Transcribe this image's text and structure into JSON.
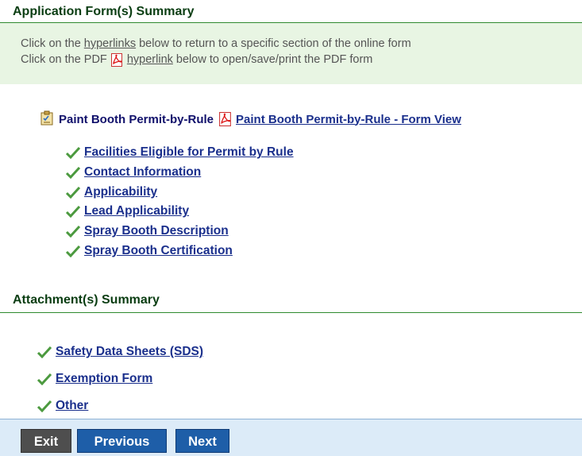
{
  "application": {
    "header": "Application Form(s) Summary",
    "info_line1_prefix": "Click on the ",
    "info_line1_link": "hyperlinks",
    "info_line1_suffix": " below to return to a specific section of the online form",
    "info_line2_prefix": "Click on the PDF ",
    "info_line2_link": "hyperlink",
    "info_line2_suffix": " below to open/save/print the PDF form",
    "form_name": "Paint Booth Permit-by-Rule",
    "form_view_link": "Paint Booth Permit-by-Rule - Form View",
    "sections": [
      "Facilities Eligible for Permit by Rule",
      "Contact Information",
      "Applicability",
      "Lead Applicability",
      "Spray Booth Description",
      "Spray Booth Certification"
    ]
  },
  "attachments": {
    "header": "Attachment(s) Summary",
    "items": [
      "Safety Data Sheets (SDS)",
      "Exemption Form",
      "Other"
    ]
  },
  "nav": {
    "exit": "Exit",
    "previous": "Previous",
    "next": "Next"
  },
  "colors": {
    "header_text": "#0a3d12",
    "header_rule": "#2f8a2f",
    "info_bg": "#e8f5e3",
    "link": "#1a2f8c",
    "check": "#4c9a3f",
    "nav_bg": "#dcebf8",
    "btn_blue": "#1e5ea8",
    "btn_gray": "#4e4e4e"
  },
  "icons": {
    "pdf": "pdf-icon",
    "form": "form-checklist-icon",
    "check": "checkmark-icon"
  }
}
